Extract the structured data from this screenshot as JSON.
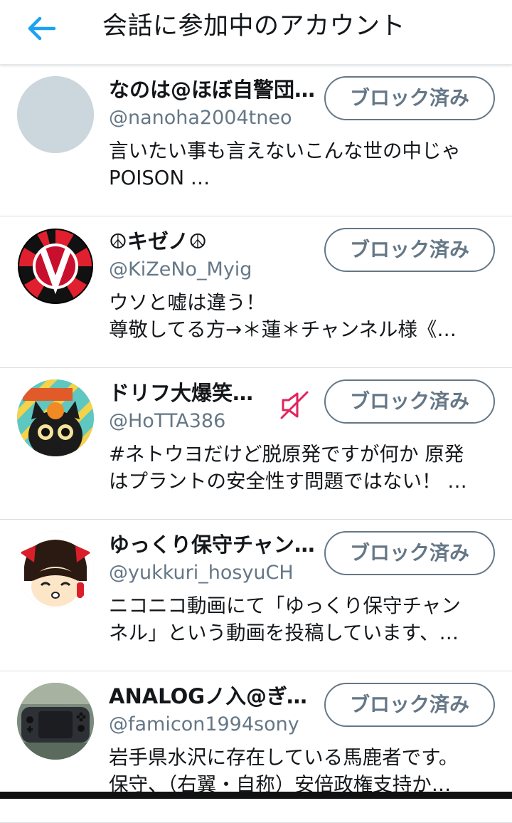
{
  "header": {
    "title": "会話に参加中のアカウント",
    "back_icon": "arrow-left-icon",
    "accent_color": "#1da1f2"
  },
  "accounts": [
    {
      "name": "なのは@ほぼ自警団…",
      "handle": "@nanoha2004tneo",
      "bio_lines": [
        "言いたい事も言えないこんな世の中じゃ",
        "POISON …"
      ],
      "button_label": "ブロック済み",
      "muted": false,
      "avatar": "default-avatar"
    },
    {
      "name": "☮キゼノ☮",
      "handle": "@KiZeNo_Myig",
      "bio_lines": [
        "ウソと嘘は違う！",
        "尊敬してる方→＊蓮＊チャンネル様《…"
      ],
      "button_label": "ブロック済み",
      "muted": false,
      "avatar": "dartboard-avatar"
    },
    {
      "name": "ドリフ大爆笑…",
      "handle": "@HoTTA386",
      "bio_lines": [
        "#ネトウヨだけど脱原発ですが何か 原発",
        "はプラントの安全性す問題ではない！ …"
      ],
      "button_label": "ブロック済み",
      "muted": true,
      "mute_icon": "muted-speaker-icon",
      "mute_color": "#e0245e",
      "avatar": "black-cat-avatar"
    },
    {
      "name": "ゆっくり保守チャン…",
      "handle": "@yukkuri_hosyuCH",
      "bio_lines": [
        "ニコニコ動画にて「ゆっくり保守チャン",
        "ネル」という動画を投稿しています、…"
      ],
      "button_label": "ブロック済み",
      "muted": false,
      "avatar": "yukkuri-avatar"
    },
    {
      "name": "ANALOGノ入@ぎっ…",
      "handle": "@famicon1994sony",
      "bio_lines": [
        "岩手県水沢に存在している馬鹿者です。",
        "保守、（右翼・自称）安倍政権支持か…"
      ],
      "button_label": "ブロック済み",
      "muted": false,
      "avatar": "game-console-avatar"
    }
  ]
}
